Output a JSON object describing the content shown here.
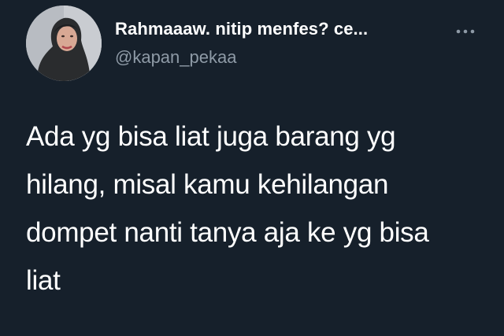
{
  "tweet": {
    "author": {
      "display_name": "Rahmaaaw. nitip menfes? ce...",
      "handle": "@kapan_pekaa",
      "avatar_icon": "profile-photo"
    },
    "more_icon": "more-horizontal-icon",
    "text": "Ada yg bisa liat juga barang yg\nhilang, misal kamu kehilangan\ndompet nanti tanya aja ke yg bisa\nliat"
  },
  "colors": {
    "background": "#16202b",
    "name": "#ffffff",
    "handle": "#8e9aa6",
    "text": "#ffffff"
  }
}
